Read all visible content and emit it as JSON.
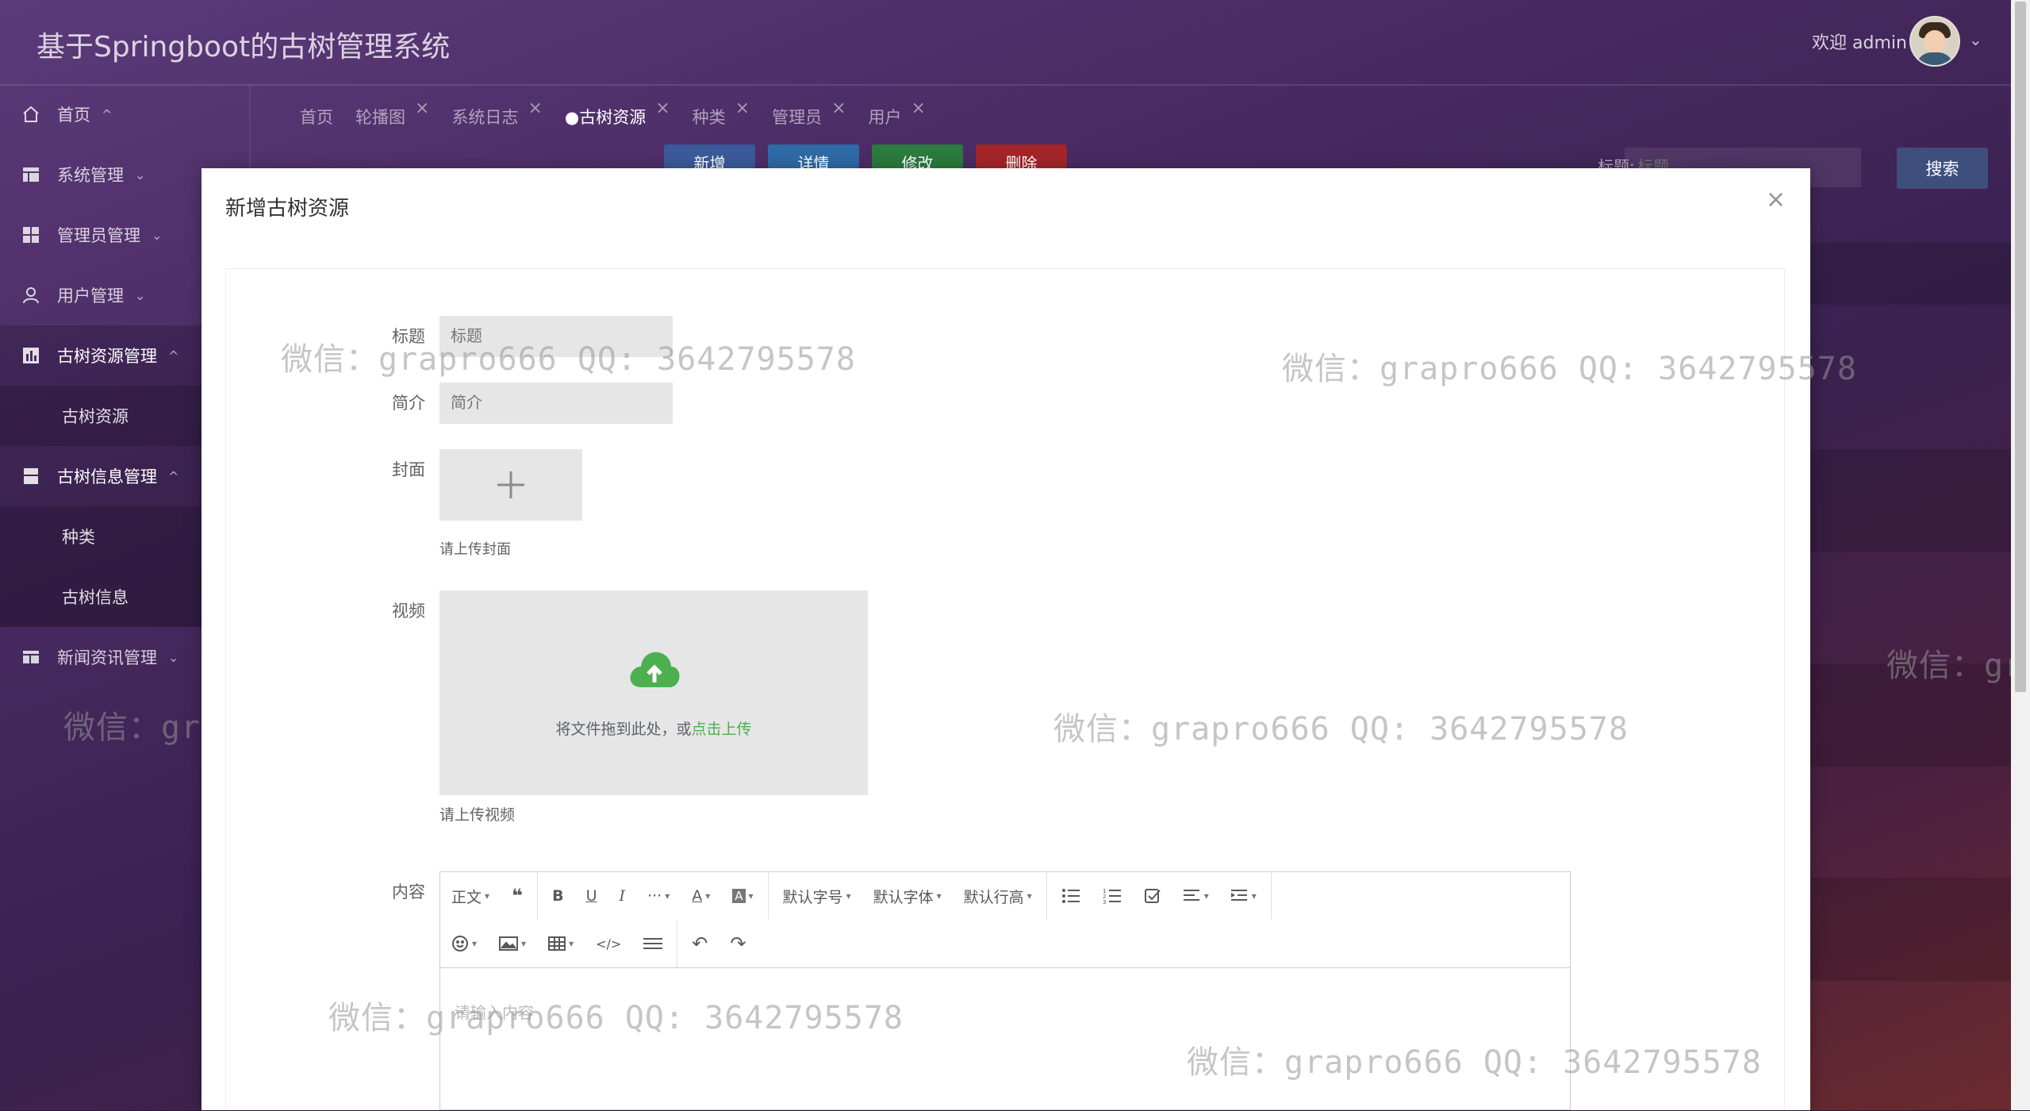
{
  "app": {
    "title": "基于Springboot的古树管理系统",
    "welcome": "欢迎 admin"
  },
  "sidebar": {
    "items": [
      {
        "label": "首页",
        "icon": "home-icon"
      },
      {
        "label": "系统管理",
        "icon": "table-icon"
      },
      {
        "label": "管理员管理",
        "icon": "grid-icon"
      },
      {
        "label": "用户管理",
        "icon": "user-icon"
      },
      {
        "label": "古树资源管理",
        "icon": "chart-icon"
      },
      {
        "label": "古树信息管理",
        "icon": "server-icon"
      },
      {
        "label": "新闻资讯管理",
        "icon": "news-icon"
      }
    ],
    "sub_resource": [
      "古树资源"
    ],
    "sub_info": [
      "种类",
      "古树信息"
    ]
  },
  "tabs": [
    "首页",
    "轮播图",
    "系统日志",
    "●古树资源",
    "种类",
    "管理员",
    "用户"
  ],
  "toolbar": {
    "add": "新增",
    "detail": "详情",
    "edit": "修改",
    "delete": "删除",
    "search_label": "标题:",
    "search_placeholder": "标题",
    "search_button": "搜索"
  },
  "modal": {
    "title": "新增古树资源",
    "fields": {
      "title_label": "标题",
      "title_placeholder": "标题",
      "intro_label": "简介",
      "intro_placeholder": "简介",
      "cover_label": "封面",
      "cover_hint": "请上传封面",
      "video_label": "视频",
      "video_drop_text": "将文件拖到此处，或",
      "video_drop_link": "点击上传",
      "video_hint": "请上传视频",
      "content_label": "内容",
      "content_placeholder": "请输入内容"
    },
    "editor": {
      "paragraph": "正文",
      "font_size": "默认字号",
      "font_family": "默认字体",
      "line_height": "默认行高",
      "more": "···",
      "font_color": "A"
    }
  },
  "watermark": "微信：grapro666 QQ: 3642795578",
  "watermark_partial": "微信：gra",
  "colors": {
    "btn_add": "#3b5a9a",
    "btn_detail": "#2e6aa6",
    "btn_edit": "#2b7a3e",
    "btn_delete": "#a3252a",
    "upload_green": "#4caf50"
  }
}
